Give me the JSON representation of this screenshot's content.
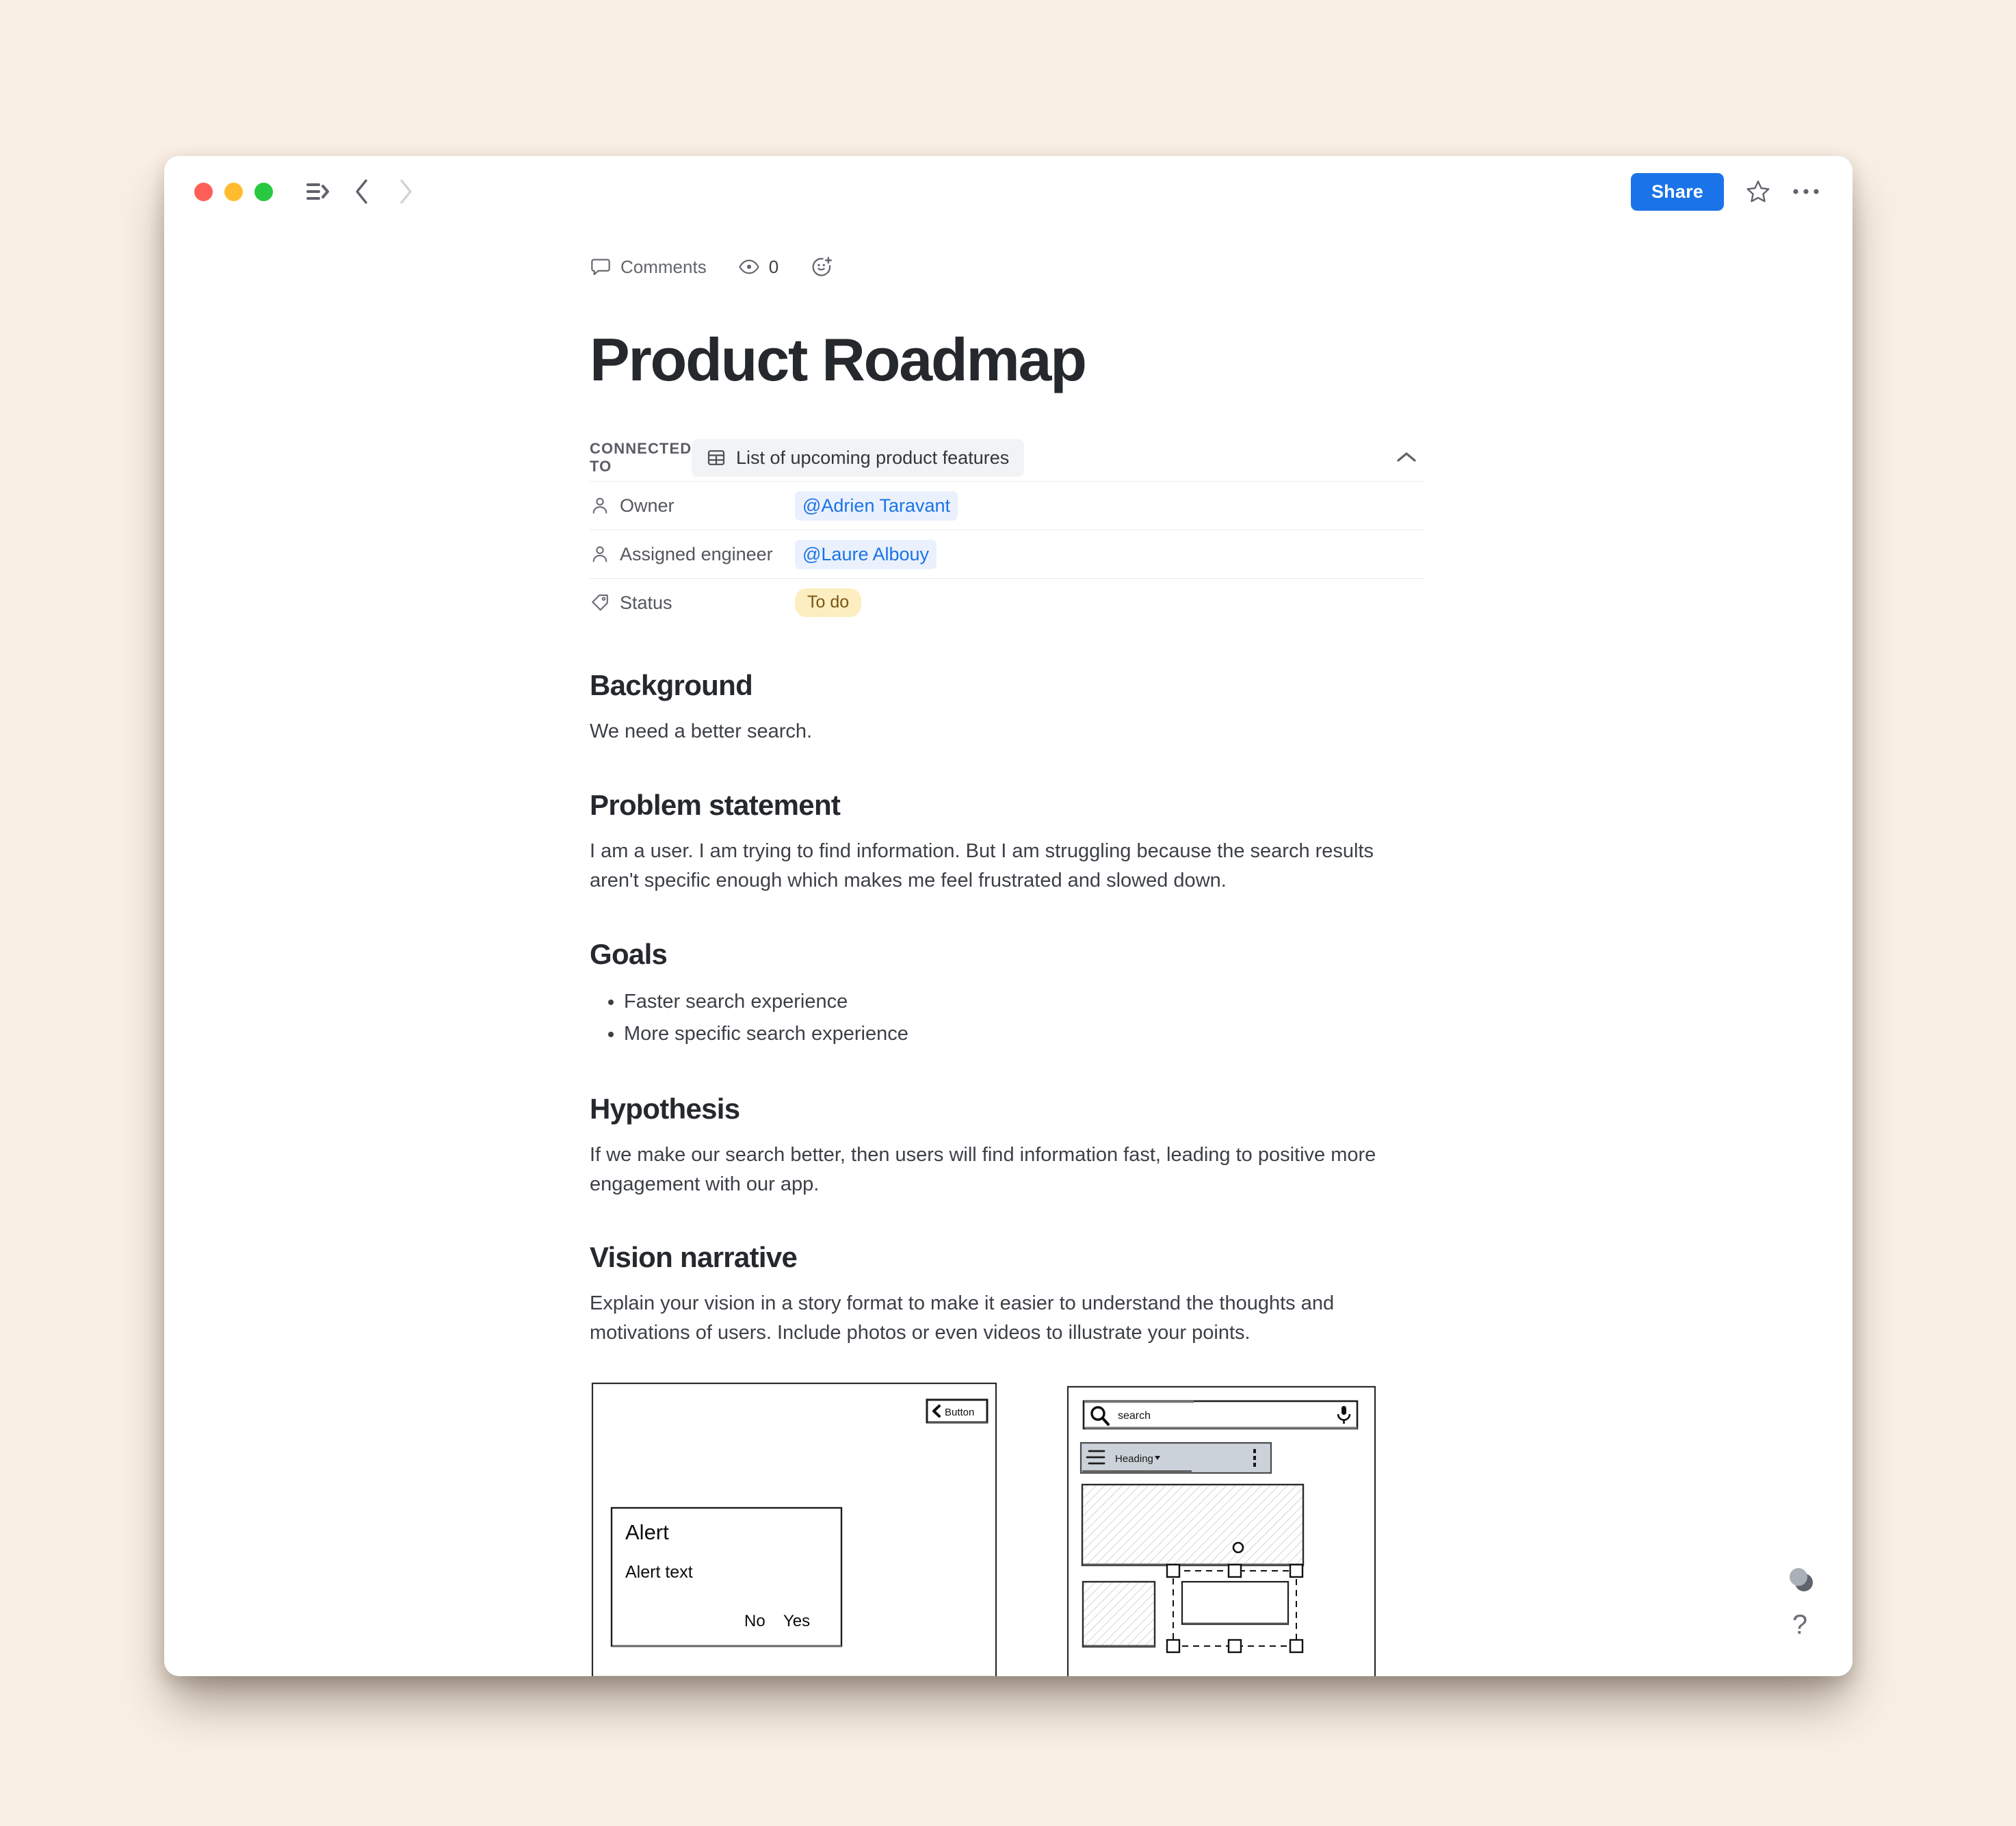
{
  "window": {
    "traffic_lights": [
      "close",
      "minimize",
      "maximize"
    ],
    "sidebar_toggle_icon": "sidebar-expand-icon",
    "back_icon": "chevron-left-icon",
    "forward_icon": "chevron-right-icon",
    "share_label": "Share",
    "favorite_icon": "star-icon",
    "more_icon": "ellipsis-icon"
  },
  "meta": {
    "comments_icon": "comment-bubble-icon",
    "comments_label": "Comments",
    "views_icon": "eye-icon",
    "views_count": "0",
    "reaction_icon": "add-reaction-icon"
  },
  "document": {
    "title": "Product Roadmap"
  },
  "connected": {
    "label": "CONNECTED TO",
    "source_icon": "table-icon",
    "source_name": "List of upcoming product features",
    "collapse_icon": "chevron-up-icon",
    "properties": [
      {
        "icon": "person-icon",
        "name": "Owner",
        "value": "@Adrien Taravant",
        "type": "mention"
      },
      {
        "icon": "person-icon",
        "name": "Assigned engineer",
        "value": "@Laure Albouy",
        "type": "mention"
      },
      {
        "icon": "tag-icon",
        "name": "Status",
        "value": "To do",
        "type": "pill"
      }
    ]
  },
  "sections": [
    {
      "heading": "Background",
      "paragraph": "We need a better search."
    },
    {
      "heading": "Problem statement",
      "paragraph": "I am a user. I am trying to find information. But I am struggling because the search results aren't specific enough which makes me feel frustrated and slowed down."
    },
    {
      "heading": "Goals",
      "bullets": [
        "Faster search experience",
        "More specific search experience"
      ]
    },
    {
      "heading": "Hypothesis",
      "paragraph": "If we make our search better, then users will find information fast, leading to positive more engagement with our app."
    },
    {
      "heading": "Vision narrative",
      "paragraph": "Explain your vision in a story format to make it easier to understand the thoughts and motivations of users. Include photos or even videos to illustrate your points."
    }
  ],
  "wireframes": {
    "alert_mockup": {
      "button_label": "Button",
      "back_arrow_icon": "chevron-left-icon",
      "alert_title": "Alert",
      "alert_body": "Alert text",
      "action_no": "No",
      "action_yes": "Yes"
    },
    "search_mockup": {
      "search_icon": "magnifier-icon",
      "search_placeholder": "search",
      "mic_icon": "microphone-icon",
      "menu_icon": "hamburger-icon",
      "heading_label": "Heading",
      "heading_caret_icon": "caret-down-icon",
      "overflow_icon": "vertical-dots-icon"
    }
  },
  "floating": {
    "stack_icon": "overlapping-circles-icon",
    "help_label": "?"
  },
  "colors": {
    "desktop_background": "#f9efe4",
    "accent_blue": "#1a73e8",
    "mention_background": "#eaf1fd",
    "status_background": "#fceec0",
    "status_text": "#7a5418",
    "traffic_red": "#ff5f57",
    "traffic_yellow": "#febc2e",
    "traffic_green": "#28c840"
  }
}
